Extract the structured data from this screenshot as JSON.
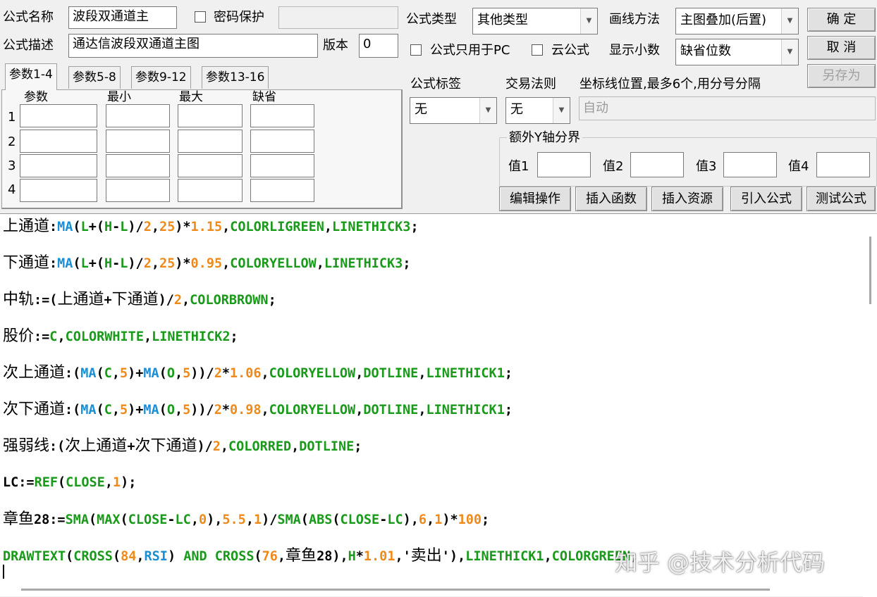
{
  "header": {
    "name_label": "公式名称",
    "name_value": "波段双通道主",
    "password_label": "密码保护",
    "password_value": "",
    "desc_label": "公式描述",
    "desc_value": "通达信波段双通道主图",
    "version_label": "版本",
    "version_value": "0",
    "type_label": "公式类型",
    "type_value": "其他类型",
    "draw_label": "画线方法",
    "draw_value": "主图叠加(后置)",
    "pc_only_label": "公式只用于PC",
    "cloud_label": "云公式",
    "decimal_label": "显示小数",
    "decimal_value": "缺省位数"
  },
  "buttons": {
    "ok": "确  定",
    "cancel": "取  消",
    "save_as": "另存为",
    "edit_ops": "编辑操作",
    "insert_func": "插入函数",
    "insert_res": "插入资源",
    "import_formula": "引入公式",
    "test_formula": "测试公式"
  },
  "tabs": [
    "参数1-4",
    "参数5-8",
    "参数9-12",
    "参数13-16"
  ],
  "params": {
    "headers": [
      "参数",
      "最小",
      "最大",
      "缺省"
    ],
    "rows": [
      "1",
      "2",
      "3",
      "4"
    ]
  },
  "tag": {
    "label": "公式标签",
    "value": "无"
  },
  "trade": {
    "label": "交易法则",
    "value": "无"
  },
  "coord": {
    "label": "坐标线位置,最多6个,用分号分隔",
    "value": "自动"
  },
  "yaxis": {
    "title": "额外Y轴分界",
    "labels": [
      "值1",
      "值2",
      "值3",
      "值4"
    ]
  },
  "code_colors": {
    "text": "#000000",
    "function": "#1a8fd6",
    "number": "#ef8a1a",
    "keyword": "#1a9a1a"
  },
  "code_lines": [
    [
      [
        "上通道",
        "c"
      ],
      [
        ":",
        "t"
      ],
      [
        "MA",
        "f"
      ],
      [
        "(",
        "t"
      ],
      [
        "L",
        "k"
      ],
      [
        "+(",
        "t"
      ],
      [
        "H",
        "k"
      ],
      [
        "-",
        "t"
      ],
      [
        "L",
        "k"
      ],
      [
        ")/",
        "t"
      ],
      [
        "2",
        "n"
      ],
      [
        ",",
        "t"
      ],
      [
        "25",
        "n"
      ],
      [
        ")*",
        "t"
      ],
      [
        "1.15",
        "n"
      ],
      [
        ",",
        "t"
      ],
      [
        "COLORLIGREEN",
        "k"
      ],
      [
        ",",
        "t"
      ],
      [
        "LINETHICK3",
        "k"
      ],
      [
        ";",
        "t"
      ]
    ],
    [
      [
        "下通道",
        "c"
      ],
      [
        ":",
        "t"
      ],
      [
        "MA",
        "f"
      ],
      [
        "(",
        "t"
      ],
      [
        "L",
        "k"
      ],
      [
        "+(",
        "t"
      ],
      [
        "H",
        "k"
      ],
      [
        "-",
        "t"
      ],
      [
        "L",
        "k"
      ],
      [
        ")/",
        "t"
      ],
      [
        "2",
        "n"
      ],
      [
        ",",
        "t"
      ],
      [
        "25",
        "n"
      ],
      [
        ")*",
        "t"
      ],
      [
        "0.95",
        "n"
      ],
      [
        ",",
        "t"
      ],
      [
        "COLORYELLOW",
        "k"
      ],
      [
        ",",
        "t"
      ],
      [
        "LINETHICK3",
        "k"
      ],
      [
        ";",
        "t"
      ]
    ],
    [
      [
        "中轨",
        "c"
      ],
      [
        ":=(",
        "t"
      ],
      [
        "上通道",
        "c"
      ],
      [
        "+",
        "t"
      ],
      [
        "下通道",
        "c"
      ],
      [
        ")/",
        "t"
      ],
      [
        "2",
        "n"
      ],
      [
        ",",
        "t"
      ],
      [
        "COLORBROWN",
        "k"
      ],
      [
        ";",
        "t"
      ]
    ],
    [
      [
        "股价",
        "c"
      ],
      [
        ":=",
        "t"
      ],
      [
        "C",
        "k"
      ],
      [
        ",",
        "t"
      ],
      [
        "COLORWHITE",
        "k"
      ],
      [
        ",",
        "t"
      ],
      [
        "LINETHICK2",
        "k"
      ],
      [
        ";",
        "t"
      ]
    ],
    [
      [
        "次上通道",
        "c"
      ],
      [
        ":(",
        "t"
      ],
      [
        "MA",
        "f"
      ],
      [
        "(",
        "t"
      ],
      [
        "C",
        "k"
      ],
      [
        ",",
        "t"
      ],
      [
        "5",
        "n"
      ],
      [
        ")+",
        "t"
      ],
      [
        "MA",
        "f"
      ],
      [
        "(",
        "t"
      ],
      [
        "O",
        "k"
      ],
      [
        ",",
        "t"
      ],
      [
        "5",
        "n"
      ],
      [
        "))/",
        "t"
      ],
      [
        "2",
        "n"
      ],
      [
        "*",
        "t"
      ],
      [
        "1.06",
        "n"
      ],
      [
        ",",
        "t"
      ],
      [
        "COLORYELLOW",
        "k"
      ],
      [
        ",",
        "t"
      ],
      [
        "DOTLINE",
        "k"
      ],
      [
        ",",
        "t"
      ],
      [
        "LINETHICK1",
        "k"
      ],
      [
        ";",
        "t"
      ]
    ],
    [
      [
        "次下通道",
        "c"
      ],
      [
        ":(",
        "t"
      ],
      [
        "MA",
        "f"
      ],
      [
        "(",
        "t"
      ],
      [
        "C",
        "k"
      ],
      [
        ",",
        "t"
      ],
      [
        "5",
        "n"
      ],
      [
        ")+",
        "t"
      ],
      [
        "MA",
        "f"
      ],
      [
        "(",
        "t"
      ],
      [
        "O",
        "k"
      ],
      [
        ",",
        "t"
      ],
      [
        "5",
        "n"
      ],
      [
        "))/",
        "t"
      ],
      [
        "2",
        "n"
      ],
      [
        "*",
        "t"
      ],
      [
        "0.98",
        "n"
      ],
      [
        ",",
        "t"
      ],
      [
        "COLORYELLOW",
        "k"
      ],
      [
        ",",
        "t"
      ],
      [
        "DOTLINE",
        "k"
      ],
      [
        ",",
        "t"
      ],
      [
        "LINETHICK1",
        "k"
      ],
      [
        ";",
        "t"
      ]
    ],
    [
      [
        "强弱线",
        "c"
      ],
      [
        ":(",
        "t"
      ],
      [
        "次上通道",
        "c"
      ],
      [
        "+",
        "t"
      ],
      [
        "次下通道",
        "c"
      ],
      [
        ")/",
        "t"
      ],
      [
        "2",
        "n"
      ],
      [
        ",",
        "t"
      ],
      [
        "COLORRED",
        "k"
      ],
      [
        ",",
        "t"
      ],
      [
        "DOTLINE",
        "k"
      ],
      [
        ";",
        "t"
      ]
    ],
    [
      [
        "LC",
        "t"
      ],
      [
        ":=",
        "t"
      ],
      [
        "REF",
        "k"
      ],
      [
        "(",
        "t"
      ],
      [
        "CLOSE",
        "k"
      ],
      [
        ",",
        "t"
      ],
      [
        "1",
        "n"
      ],
      [
        ");",
        "t"
      ]
    ],
    [
      [
        "章鱼",
        "c"
      ],
      [
        "28",
        "t"
      ],
      [
        ":=",
        "t"
      ],
      [
        "SMA",
        "k"
      ],
      [
        "(",
        "t"
      ],
      [
        "MAX",
        "k"
      ],
      [
        "(",
        "t"
      ],
      [
        "CLOSE",
        "k"
      ],
      [
        "-",
        "t"
      ],
      [
        "LC",
        "k"
      ],
      [
        ",",
        "t"
      ],
      [
        "0",
        "n"
      ],
      [
        "),",
        "t"
      ],
      [
        "5.5",
        "n"
      ],
      [
        ",",
        "t"
      ],
      [
        "1",
        "n"
      ],
      [
        ")/",
        "t"
      ],
      [
        "SMA",
        "k"
      ],
      [
        "(",
        "t"
      ],
      [
        "ABS",
        "k"
      ],
      [
        "(",
        "t"
      ],
      [
        "CLOSE",
        "k"
      ],
      [
        "-",
        "t"
      ],
      [
        "LC",
        "k"
      ],
      [
        "),",
        "t"
      ],
      [
        "6",
        "n"
      ],
      [
        ",",
        "t"
      ],
      [
        "1",
        "n"
      ],
      [
        ")*",
        "t"
      ],
      [
        "100",
        "n"
      ],
      [
        ";",
        "t"
      ]
    ],
    [
      [
        "DRAWTEXT",
        "k"
      ],
      [
        "(",
        "t"
      ],
      [
        "CROSS",
        "k"
      ],
      [
        "(",
        "t"
      ],
      [
        "84",
        "n"
      ],
      [
        ",",
        "t"
      ],
      [
        "RSI",
        "f"
      ],
      [
        ") ",
        "t"
      ],
      [
        "AND",
        "k"
      ],
      [
        " ",
        "t"
      ],
      [
        "CROSS",
        "k"
      ],
      [
        "(",
        "t"
      ],
      [
        "76",
        "n"
      ],
      [
        ",",
        "t"
      ],
      [
        "章鱼",
        "c"
      ],
      [
        "28",
        "t"
      ],
      [
        "),",
        "t"
      ],
      [
        "H",
        "k"
      ],
      [
        "*",
        "t"
      ],
      [
        "1.01",
        "n"
      ],
      [
        ",",
        "t"
      ],
      [
        "'",
        "t"
      ],
      [
        "卖出",
        "c"
      ],
      [
        "'",
        "t"
      ],
      [
        "),",
        "t"
      ],
      [
        "LINETHICK1",
        "k"
      ],
      [
        ",",
        "t"
      ],
      [
        "COLORGREEN",
        "k"
      ],
      [
        ";",
        "t"
      ]
    ]
  ],
  "watermark": "知乎 @技术分析代码"
}
